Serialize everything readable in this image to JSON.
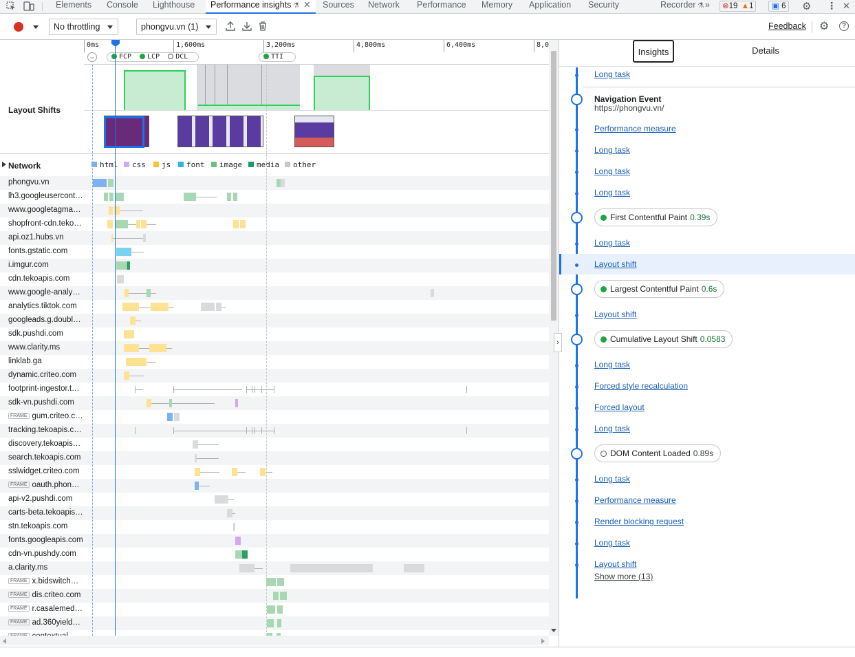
{
  "tabs": [
    {
      "label": "Elements",
      "active": false
    },
    {
      "label": "Console",
      "active": false
    },
    {
      "label": "Lighthouse",
      "active": false
    },
    {
      "label": "Performance insights",
      "active": true
    },
    {
      "label": "Sources",
      "active": false
    },
    {
      "label": "Network",
      "active": false
    },
    {
      "label": "Performance",
      "active": false
    },
    {
      "label": "Memory",
      "active": false
    },
    {
      "label": "Application",
      "active": false
    },
    {
      "label": "Security",
      "active": false
    },
    {
      "label": "Recorder",
      "active": false
    }
  ],
  "badges": {
    "errors": "19",
    "warnings": "1",
    "messages": "6"
  },
  "toolbar": {
    "throttling": "No throttling",
    "recording": "phongvu.vn (1)",
    "feedback": "Feedback"
  },
  "ruler": {
    "ticks": [
      "0ms",
      "1,600ms",
      "3,200ms",
      "4,800ms",
      "6,400ms",
      "8,0"
    ],
    "markers": [
      "FCP",
      "LCP",
      "DCL",
      "TTI"
    ]
  },
  "tracks": {
    "layout_shifts": "Layout Shifts",
    "network": "Network"
  },
  "legend": [
    "html",
    "css",
    "js",
    "font",
    "image",
    "media",
    "other"
  ],
  "colors": {
    "html": "#7eb1f2",
    "css": "#d7a6f0",
    "js": "#fde293",
    "font": "#79d3f0",
    "image": "#a8d8b3",
    "media": "#1a9c6a",
    "other": "#d9dadc",
    "accent": "#1a73e8"
  },
  "network_rows": [
    {
      "domain": "phongvu.vn",
      "frame": false
    },
    {
      "domain": "lh3.googleusercont…",
      "frame": false
    },
    {
      "domain": "www.googletagma…",
      "frame": false
    },
    {
      "domain": "shopfront-cdn.teko…",
      "frame": false
    },
    {
      "domain": "api.oz1.hubs.vn",
      "frame": false
    },
    {
      "domain": "fonts.gstatic.com",
      "frame": false
    },
    {
      "domain": "i.imgur.com",
      "frame": false
    },
    {
      "domain": "cdn.tekoapis.com",
      "frame": false
    },
    {
      "domain": "www.google-analy…",
      "frame": false
    },
    {
      "domain": "analytics.tiktok.com",
      "frame": false
    },
    {
      "domain": "googleads.g.doubl…",
      "frame": false
    },
    {
      "domain": "sdk.pushdi.com",
      "frame": false
    },
    {
      "domain": "www.clarity.ms",
      "frame": false
    },
    {
      "domain": "linklab.ga",
      "frame": false
    },
    {
      "domain": "dynamic.criteo.com",
      "frame": false
    },
    {
      "domain": "footprint-ingestor.t…",
      "frame": false
    },
    {
      "domain": "sdk-vn.pushdi.com",
      "frame": false
    },
    {
      "domain": "gum.criteo.c…",
      "frame": true
    },
    {
      "domain": "tracking.tekoapis.c…",
      "frame": false
    },
    {
      "domain": "discovery.tekoapis…",
      "frame": false
    },
    {
      "domain": "search.tekoapis.com",
      "frame": false
    },
    {
      "domain": "sslwidget.criteo.com",
      "frame": false
    },
    {
      "domain": "oauth.phon…",
      "frame": true
    },
    {
      "domain": "api-v2.pushdi.com",
      "frame": false
    },
    {
      "domain": "carts-beta.tekoapis…",
      "frame": false
    },
    {
      "domain": "stn.tekoapis.com",
      "frame": false
    },
    {
      "domain": "fonts.googleapis.com",
      "frame": false
    },
    {
      "domain": "cdn-vn.pushdy.com",
      "frame": false
    },
    {
      "domain": "a.clarity.ms",
      "frame": false
    },
    {
      "domain": "x.bidswitch…",
      "frame": true
    },
    {
      "domain": "dis.criteo.com",
      "frame": true
    },
    {
      "domain": "r.casalemed…",
      "frame": true
    },
    {
      "domain": "ad.360yield…",
      "frame": true
    },
    {
      "domain": "contextual…",
      "frame": true
    }
  ],
  "frame_label": "FRAME",
  "side_tabs": {
    "insights": "Insights",
    "details": "Details"
  },
  "insights": [
    {
      "kind": "link",
      "label": "Long task"
    },
    {
      "kind": "nav",
      "title": "Navigation Event",
      "url": "https://phongvu.vn/"
    },
    {
      "kind": "link",
      "label": "Performance measure"
    },
    {
      "kind": "link",
      "label": "Long task"
    },
    {
      "kind": "link",
      "label": "Long task"
    },
    {
      "kind": "link",
      "label": "Long task"
    },
    {
      "kind": "metric",
      "label": "First Contentful Paint",
      "value": "0.39s",
      "status": "good"
    },
    {
      "kind": "link",
      "label": "Long task"
    },
    {
      "kind": "link",
      "label": "Layout shift",
      "selected": true
    },
    {
      "kind": "metric",
      "label": "Largest Contentful Paint",
      "value": "0.6s",
      "status": "good"
    },
    {
      "kind": "link",
      "label": "Layout shift"
    },
    {
      "kind": "metric",
      "label": "Cumulative Layout Shift",
      "value": "0.0583",
      "status": "good"
    },
    {
      "kind": "link",
      "label": "Long task"
    },
    {
      "kind": "link",
      "label": "Forced style recalculation"
    },
    {
      "kind": "link",
      "label": "Forced layout"
    },
    {
      "kind": "link",
      "label": "Long task"
    },
    {
      "kind": "metric",
      "label": "DOM Content Loaded",
      "value": "0.89s",
      "status": "neutral"
    },
    {
      "kind": "link",
      "label": "Long task"
    },
    {
      "kind": "link",
      "label": "Performance measure"
    },
    {
      "kind": "link",
      "label": "Render blocking request"
    },
    {
      "kind": "link",
      "label": "Long task"
    },
    {
      "kind": "link",
      "label": "Layout shift"
    }
  ],
  "show_more": "Show more (13)"
}
